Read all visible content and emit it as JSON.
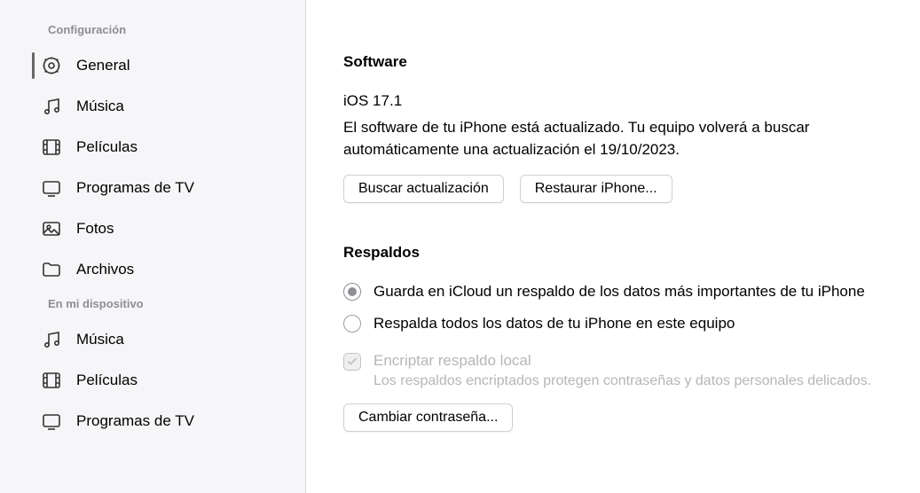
{
  "sidebar": {
    "section1_title": "Configuración",
    "section2_title": "En mi dispositivo",
    "items1": [
      {
        "label": "General"
      },
      {
        "label": "Música"
      },
      {
        "label": "Películas"
      },
      {
        "label": "Programas de TV"
      },
      {
        "label": "Fotos"
      },
      {
        "label": "Archivos"
      }
    ],
    "items2": [
      {
        "label": "Música"
      },
      {
        "label": "Películas"
      },
      {
        "label": "Programas de TV"
      }
    ]
  },
  "software": {
    "title": "Software",
    "version": "iOS 17.1",
    "status": "El software de tu iPhone está actualizado. Tu equipo volverá a buscar automáticamente una actualización el 19/10/2023.",
    "check_update": "Buscar actualización",
    "restore": "Restaurar iPhone..."
  },
  "backups": {
    "title": "Respaldos",
    "option_icloud": "Guarda en iCloud un respaldo de los datos más importantes de tu iPhone",
    "option_local": "Respalda todos los datos de tu iPhone en este equipo",
    "encrypt_label": "Encriptar respaldo local",
    "encrypt_sub": "Los respaldos encriptados protegen contraseñas y datos personales delicados.",
    "change_password": "Cambiar contraseña...",
    "selected": "icloud",
    "encrypt_checked": true
  }
}
